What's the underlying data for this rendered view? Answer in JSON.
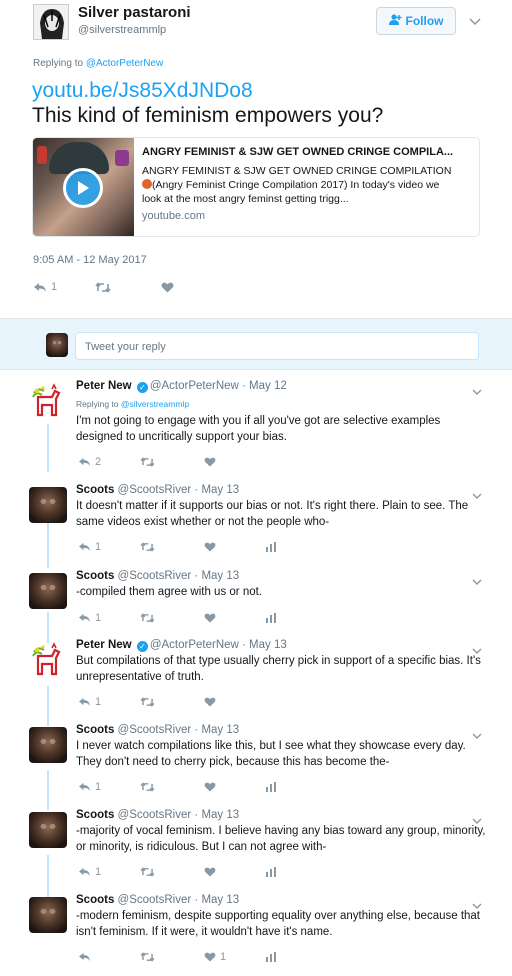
{
  "author": {
    "name": "Silver pastaroni",
    "handle": "@silverstreammlp",
    "follow_label": "Follow"
  },
  "tweet": {
    "replying_prefix": "Replying to",
    "replying_to": "@ActorPeterNew",
    "link": "youtu.be/Js85XdJNDo8",
    "text": "This kind of feminism empowers you?",
    "card": {
      "title": "ANGRY FEMINIST & SJW GET OWNED CRINGE COMPILA...",
      "desc_line1": "ANGRY FEMINIST & SJW GET OWNED CRINGE COMPILATION",
      "desc_line2": "(Angry Feminist Cringe Compilation 2017) In today's video we",
      "desc_line3": "look at the most angry feminst getting trigg...",
      "domain": "youtube.com"
    },
    "timestamp": "9:05 AM - 12 May 2017",
    "reply_count": "1"
  },
  "compose": {
    "placeholder": "Tweet your reply"
  },
  "replies": [
    {
      "name": "Peter New",
      "handle": "@ActorPeterNew",
      "date": "· May 12",
      "replying_prefix": "Replying to",
      "replying_to": "@silverstreammlp",
      "line1": "I'm not going to engage with you if all you've got are selective examples",
      "line2": "designed to uncritically support your bias.",
      "reply_count": "2",
      "like_count": ""
    },
    {
      "name": "Scoots",
      "handle": "@ScootsRiver",
      "date": "· May 13",
      "line1": "It doesn't matter if it supports our bias or not. It's right there. Plain to see. The",
      "line2": "same videos exist whether or not the people who-",
      "reply_count": "1",
      "like_count": ""
    },
    {
      "name": "Scoots",
      "handle": "@ScootsRiver",
      "date": "· May 13",
      "line1": "-compiled them agree with us or not.",
      "line2": "",
      "reply_count": "1",
      "like_count": ""
    },
    {
      "name": "Peter New",
      "handle": "@ActorPeterNew",
      "date": "· May 13",
      "line1": "But compilations of that type usually cherry pick in support of a specific bias. It's",
      "line2": "unrepresentative of truth.",
      "reply_count": "1",
      "like_count": ""
    },
    {
      "name": "Scoots",
      "handle": "@ScootsRiver",
      "date": "· May 13",
      "line1": "I never watch compilations like this, but I see what they showcase every day.",
      "line2": "They don't need to cherry pick, because this has become the-",
      "reply_count": "1",
      "like_count": ""
    },
    {
      "name": "Scoots",
      "handle": "@ScootsRiver",
      "date": "· May 13",
      "line1": "-majority of vocal feminism. I believe having any bias toward any group, minority,",
      "line2": "or minority, is ridiculous. But I can not agree with-",
      "reply_count": "1",
      "like_count": ""
    },
    {
      "name": "Scoots",
      "handle": "@ScootsRiver",
      "date": "· May 13",
      "line1": "-modern feminism, despite supporting equality over anything else, because that",
      "line2": "isn't feminism. If it were, it wouldn't have it's name.",
      "reply_count": "",
      "like_count": "1"
    }
  ],
  "colors": {
    "accent": "#1da1f2",
    "muted": "#657786",
    "icon": "#8899a6",
    "thread_line": "#c4e4fb"
  }
}
